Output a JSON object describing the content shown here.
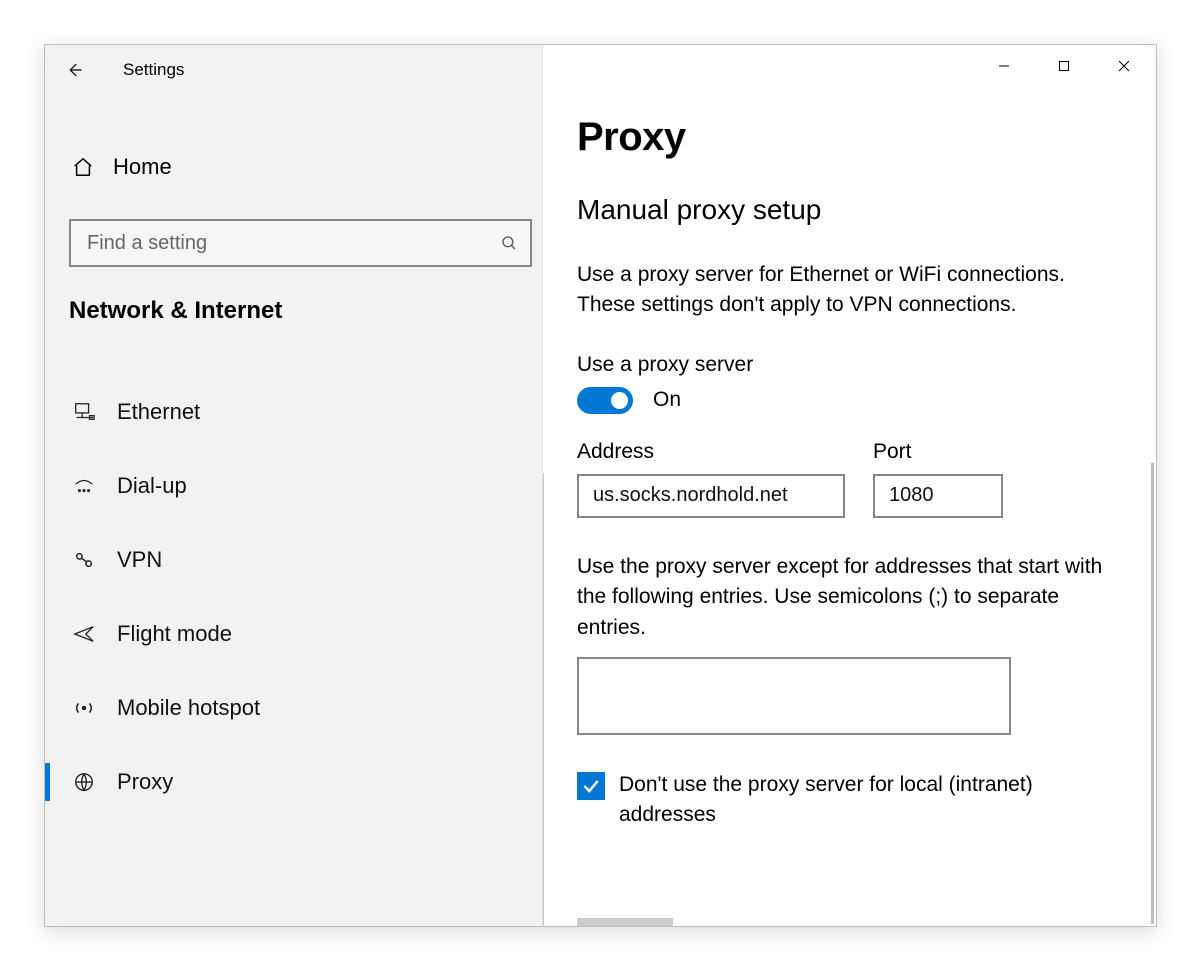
{
  "app": {
    "title": "Settings"
  },
  "sidebar": {
    "home_label": "Home",
    "search_placeholder": "Find a setting",
    "section_title": "Network & Internet",
    "items": [
      {
        "label": "Ethernet",
        "icon": "ethernet"
      },
      {
        "label": "Dial-up",
        "icon": "dial-up"
      },
      {
        "label": "VPN",
        "icon": "vpn"
      },
      {
        "label": "Flight mode",
        "icon": "flight-mode"
      },
      {
        "label": "Mobile hotspot",
        "icon": "mobile-hotspot"
      },
      {
        "label": "Proxy",
        "icon": "proxy"
      }
    ],
    "active_index": 5
  },
  "main": {
    "page_title": "Proxy",
    "section_title": "Manual proxy setup",
    "description": "Use a proxy server for Ethernet or WiFi connections. These settings don't apply to VPN connections.",
    "use_proxy_label": "Use a proxy server",
    "toggle_state_label": "On",
    "toggle_on": true,
    "address_label": "Address",
    "address_value": "us.socks.nordhold.net",
    "port_label": "Port",
    "port_value": "1080",
    "exceptions_description": "Use the proxy server except for addresses that start with the following entries. Use semicolons (;) to separate entries.",
    "exceptions_value": "",
    "bypass_local_label": "Don't use the proxy server for local (intranet) addresses",
    "bypass_local_checked": true
  },
  "colors": {
    "accent": "#0078d4",
    "sidebar_bg": "#f2f2f2"
  }
}
